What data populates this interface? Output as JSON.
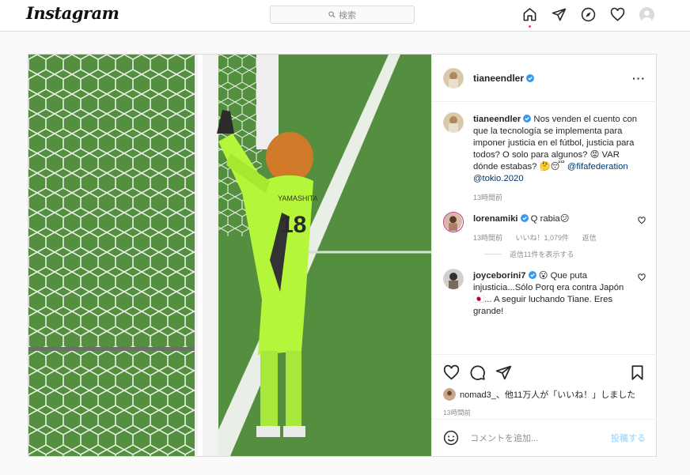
{
  "nav": {
    "logo": "Instagram",
    "search_placeholder": "検索"
  },
  "post": {
    "author": "tianeendler",
    "caption_prefix": "Nos venden el cuento con que la tecnología se implementa para imponer justicia en el fútbol, justicia para todos? O solo para algunos? 😡 VAR dónde estabas? 🤔😴",
    "mention1": "@fifafederation",
    "mention2": "@tokio.2020",
    "caption_time": "13時間前",
    "comments": [
      {
        "user": "lorenamiki",
        "text": "Q rabia😕",
        "time": "13時間前",
        "likes": "いいね！1,079件",
        "reply": "返信",
        "view_replies": "返信11件を表示する"
      },
      {
        "user": "joyceborini7",
        "text": "😮 Que puta injusticia...Sólo Porq era contra Japón 🇯🇵... A seguir luchando Tiane. Eres grande!"
      }
    ],
    "liked_by": "nomad3_、他11万人が「いいね！」しました",
    "time": "13時間前",
    "add_comment_placeholder": "コメントを追加...",
    "post_button": "投稿する",
    "jersey_name": "YAMASHITA",
    "jersey_number": "18"
  },
  "colors": {
    "verified": "#3897f0",
    "link": "#00376b",
    "post_disabled": "#b2dffc",
    "keeper_kit": "#b5f53a",
    "pitch": "#4f8a3a"
  }
}
